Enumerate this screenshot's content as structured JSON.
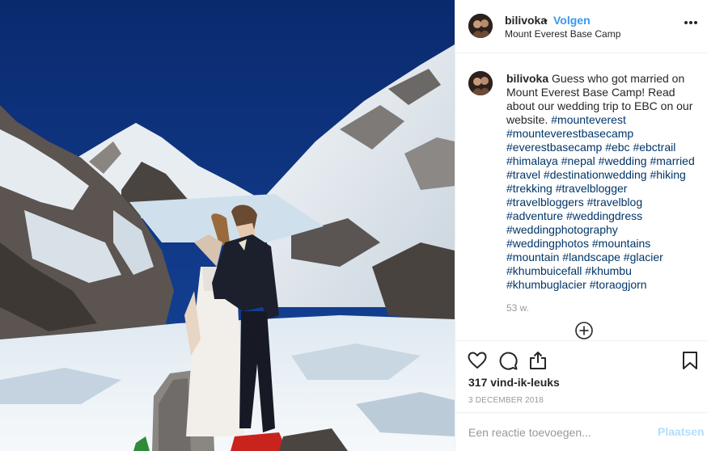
{
  "post": {
    "photo_description_icon": "mountain-wedding-photo",
    "colors": {
      "sky": "#0b2c73",
      "link": "#3897f0",
      "hashtag": "#003569",
      "muted": "#999999"
    }
  },
  "header": {
    "username": "bilivoka",
    "separator": "•",
    "follow_label": "Volgen",
    "location": "Mount Everest Base Camp",
    "more_icon": "more-options-icon"
  },
  "caption": {
    "username": "bilivoka",
    "text": "Guess who got married on Mount Everest Base Camp! Read about our wedding trip to EBC on our website.",
    "hashtags": [
      "#mounteverest",
      "#mounteverestbasecamp",
      "#everestbasecamp",
      "#ebc",
      "#ebctrail",
      "#himalaya",
      "#nepal",
      "#wedding",
      "#married",
      "#travel",
      "#destinationwedding",
      "#hiking",
      "#trekking",
      "#travelblogger",
      "#travelbloggers",
      "#travelblog",
      "#adventure",
      "#weddingdress",
      "#weddingphotography",
      "#weddingphotos",
      "#mountains",
      "#mountain",
      "#landscape",
      "#glacier",
      "#khumbuicefall",
      "#khumbu",
      "#khumbuglacier",
      "#toraogjorn"
    ],
    "age": "53 w."
  },
  "actions": {
    "icons": [
      "heart-icon",
      "comment-icon",
      "share-icon",
      "bookmark-icon"
    ],
    "likes": "317 vind-ik-leuks",
    "date": "3 DECEMBER 2018"
  },
  "comment_box": {
    "placeholder": "Een reactie toevoegen...",
    "post_label": "Plaatsen"
  }
}
